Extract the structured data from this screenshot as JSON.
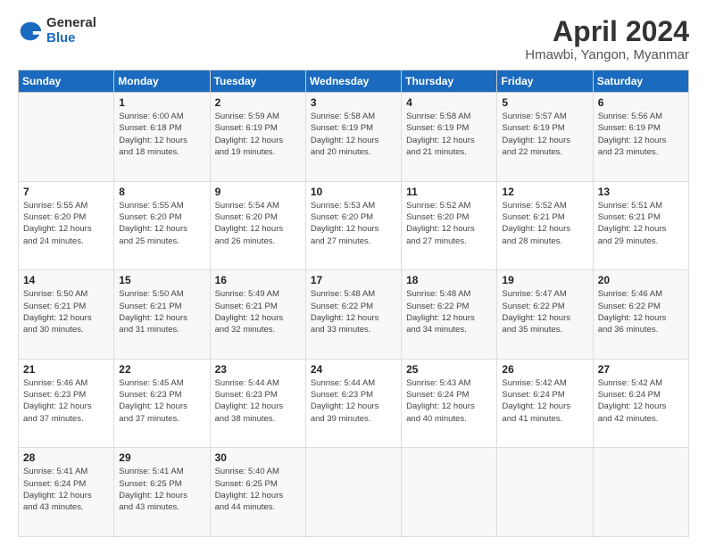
{
  "header": {
    "logo": {
      "general": "General",
      "blue": "Blue"
    },
    "title": "April 2024",
    "location": "Hmawbi, Yangon, Myanmar"
  },
  "calendar": {
    "days": [
      "Sunday",
      "Monday",
      "Tuesday",
      "Wednesday",
      "Thursday",
      "Friday",
      "Saturday"
    ],
    "weeks": [
      [
        {
          "day": "",
          "info": ""
        },
        {
          "day": "1",
          "info": "Sunrise: 6:00 AM\nSunset: 6:18 PM\nDaylight: 12 hours\nand 18 minutes."
        },
        {
          "day": "2",
          "info": "Sunrise: 5:59 AM\nSunset: 6:19 PM\nDaylight: 12 hours\nand 19 minutes."
        },
        {
          "day": "3",
          "info": "Sunrise: 5:58 AM\nSunset: 6:19 PM\nDaylight: 12 hours\nand 20 minutes."
        },
        {
          "day": "4",
          "info": "Sunrise: 5:58 AM\nSunset: 6:19 PM\nDaylight: 12 hours\nand 21 minutes."
        },
        {
          "day": "5",
          "info": "Sunrise: 5:57 AM\nSunset: 6:19 PM\nDaylight: 12 hours\nand 22 minutes."
        },
        {
          "day": "6",
          "info": "Sunrise: 5:56 AM\nSunset: 6:19 PM\nDaylight: 12 hours\nand 23 minutes."
        }
      ],
      [
        {
          "day": "7",
          "info": "Sunrise: 5:55 AM\nSunset: 6:20 PM\nDaylight: 12 hours\nand 24 minutes."
        },
        {
          "day": "8",
          "info": "Sunrise: 5:55 AM\nSunset: 6:20 PM\nDaylight: 12 hours\nand 25 minutes."
        },
        {
          "day": "9",
          "info": "Sunrise: 5:54 AM\nSunset: 6:20 PM\nDaylight: 12 hours\nand 26 minutes."
        },
        {
          "day": "10",
          "info": "Sunrise: 5:53 AM\nSunset: 6:20 PM\nDaylight: 12 hours\nand 27 minutes."
        },
        {
          "day": "11",
          "info": "Sunrise: 5:52 AM\nSunset: 6:20 PM\nDaylight: 12 hours\nand 27 minutes."
        },
        {
          "day": "12",
          "info": "Sunrise: 5:52 AM\nSunset: 6:21 PM\nDaylight: 12 hours\nand 28 minutes."
        },
        {
          "day": "13",
          "info": "Sunrise: 5:51 AM\nSunset: 6:21 PM\nDaylight: 12 hours\nand 29 minutes."
        }
      ],
      [
        {
          "day": "14",
          "info": "Sunrise: 5:50 AM\nSunset: 6:21 PM\nDaylight: 12 hours\nand 30 minutes."
        },
        {
          "day": "15",
          "info": "Sunrise: 5:50 AM\nSunset: 6:21 PM\nDaylight: 12 hours\nand 31 minutes."
        },
        {
          "day": "16",
          "info": "Sunrise: 5:49 AM\nSunset: 6:21 PM\nDaylight: 12 hours\nand 32 minutes."
        },
        {
          "day": "17",
          "info": "Sunrise: 5:48 AM\nSunset: 6:22 PM\nDaylight: 12 hours\nand 33 minutes."
        },
        {
          "day": "18",
          "info": "Sunrise: 5:48 AM\nSunset: 6:22 PM\nDaylight: 12 hours\nand 34 minutes."
        },
        {
          "day": "19",
          "info": "Sunrise: 5:47 AM\nSunset: 6:22 PM\nDaylight: 12 hours\nand 35 minutes."
        },
        {
          "day": "20",
          "info": "Sunrise: 5:46 AM\nSunset: 6:22 PM\nDaylight: 12 hours\nand 36 minutes."
        }
      ],
      [
        {
          "day": "21",
          "info": "Sunrise: 5:46 AM\nSunset: 6:23 PM\nDaylight: 12 hours\nand 37 minutes."
        },
        {
          "day": "22",
          "info": "Sunrise: 5:45 AM\nSunset: 6:23 PM\nDaylight: 12 hours\nand 37 minutes."
        },
        {
          "day": "23",
          "info": "Sunrise: 5:44 AM\nSunset: 6:23 PM\nDaylight: 12 hours\nand 38 minutes."
        },
        {
          "day": "24",
          "info": "Sunrise: 5:44 AM\nSunset: 6:23 PM\nDaylight: 12 hours\nand 39 minutes."
        },
        {
          "day": "25",
          "info": "Sunrise: 5:43 AM\nSunset: 6:24 PM\nDaylight: 12 hours\nand 40 minutes."
        },
        {
          "day": "26",
          "info": "Sunrise: 5:42 AM\nSunset: 6:24 PM\nDaylight: 12 hours\nand 41 minutes."
        },
        {
          "day": "27",
          "info": "Sunrise: 5:42 AM\nSunset: 6:24 PM\nDaylight: 12 hours\nand 42 minutes."
        }
      ],
      [
        {
          "day": "28",
          "info": "Sunrise: 5:41 AM\nSunset: 6:24 PM\nDaylight: 12 hours\nand 43 minutes."
        },
        {
          "day": "29",
          "info": "Sunrise: 5:41 AM\nSunset: 6:25 PM\nDaylight: 12 hours\nand 43 minutes."
        },
        {
          "day": "30",
          "info": "Sunrise: 5:40 AM\nSunset: 6:25 PM\nDaylight: 12 hours\nand 44 minutes."
        },
        {
          "day": "",
          "info": ""
        },
        {
          "day": "",
          "info": ""
        },
        {
          "day": "",
          "info": ""
        },
        {
          "day": "",
          "info": ""
        }
      ]
    ]
  }
}
